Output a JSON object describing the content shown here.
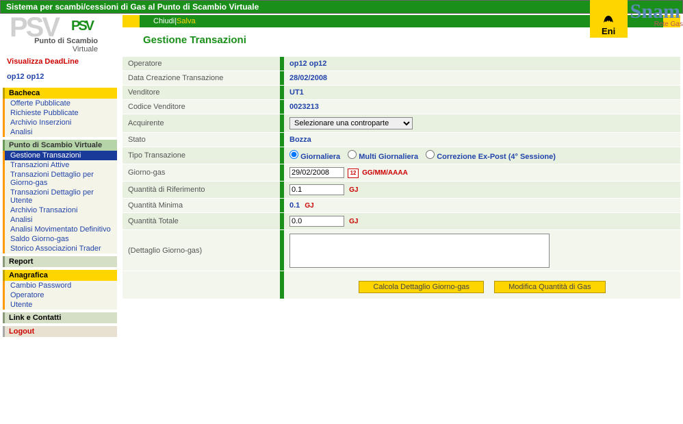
{
  "header": {
    "systemTitle": "Sistema per scambi/cessioni di Gas al Punto di Scambio Virtuale",
    "eni": "Eni",
    "snam": "Snam",
    "snamSub": "Rete Gas"
  },
  "logo": {
    "big": "PSV",
    "small": "PSV",
    "line1": "Punto di Scambio",
    "line2": "Virtuale"
  },
  "deadline": "Visualizza DeadLine",
  "user": "op12 op12",
  "nav": {
    "bacheca": {
      "title": "Bacheca",
      "items": [
        "Offerte Pubblicate",
        "Richieste Pubblicate",
        "Archivio Inserzioni",
        "Analisi"
      ]
    },
    "psv": {
      "title": "Punto di Scambio Virtuale",
      "items": [
        "Gestione Transazioni",
        "Transazioni Attive",
        "Transazioni Dettaglio per Giorno-gas",
        "Transazioni Dettaglio per Utente",
        "Archivio Transazioni",
        "Analisi",
        "Analisi Movimentato Definitivo",
        "Saldo Giorno-gas",
        "Storico Associazioni Trader"
      ]
    },
    "report": {
      "title": "Report"
    },
    "anagrafica": {
      "title": "Anagrafica",
      "items": [
        "Cambio Password",
        "Operatore",
        "Utente"
      ]
    },
    "link": {
      "title": "Link e Contatti"
    },
    "logout": "Logout"
  },
  "actions": {
    "chiudi": "Chiudi",
    "sep": " | ",
    "salva": "Salva"
  },
  "page": {
    "title": "Gestione Transazioni"
  },
  "form": {
    "operatore": {
      "label": "Operatore",
      "value": "op12 op12"
    },
    "dataCreazione": {
      "label": "Data Creazione Transazione",
      "value": "28/02/2008"
    },
    "venditore": {
      "label": "Venditore",
      "value": "UT1"
    },
    "codiceVenditore": {
      "label": "Codice Venditore",
      "value": "0023213"
    },
    "acquirente": {
      "label": "Acquirente",
      "placeholder": "Selezionare una controparte"
    },
    "stato": {
      "label": "Stato",
      "value": "Bozza"
    },
    "tipo": {
      "label": "Tipo Transazione",
      "opt1": "Giornaliera",
      "opt2": "Multi Giornaliera",
      "opt3": "Correzione Ex-Post (4° Sessione)"
    },
    "giornoGas": {
      "label": "Giorno-gas",
      "value": "29/02/2008",
      "hint": "GG/MM/AAAA"
    },
    "qtaRif": {
      "label": "Quantità di Riferimento",
      "value": "0.1",
      "unit": "GJ"
    },
    "qtaMin": {
      "label": "Quantità Minima",
      "value": "0.1",
      "unit": "GJ"
    },
    "qtaTot": {
      "label": "Quantità Totale",
      "value": "0.0",
      "unit": "GJ"
    },
    "dettaglio": {
      "label": "(Dettaglio Giorno-gas)"
    }
  },
  "buttons": {
    "calcola": "Calcola Dettaglio Giorno-gas",
    "modifica": "Modifica Quantità di Gas"
  }
}
